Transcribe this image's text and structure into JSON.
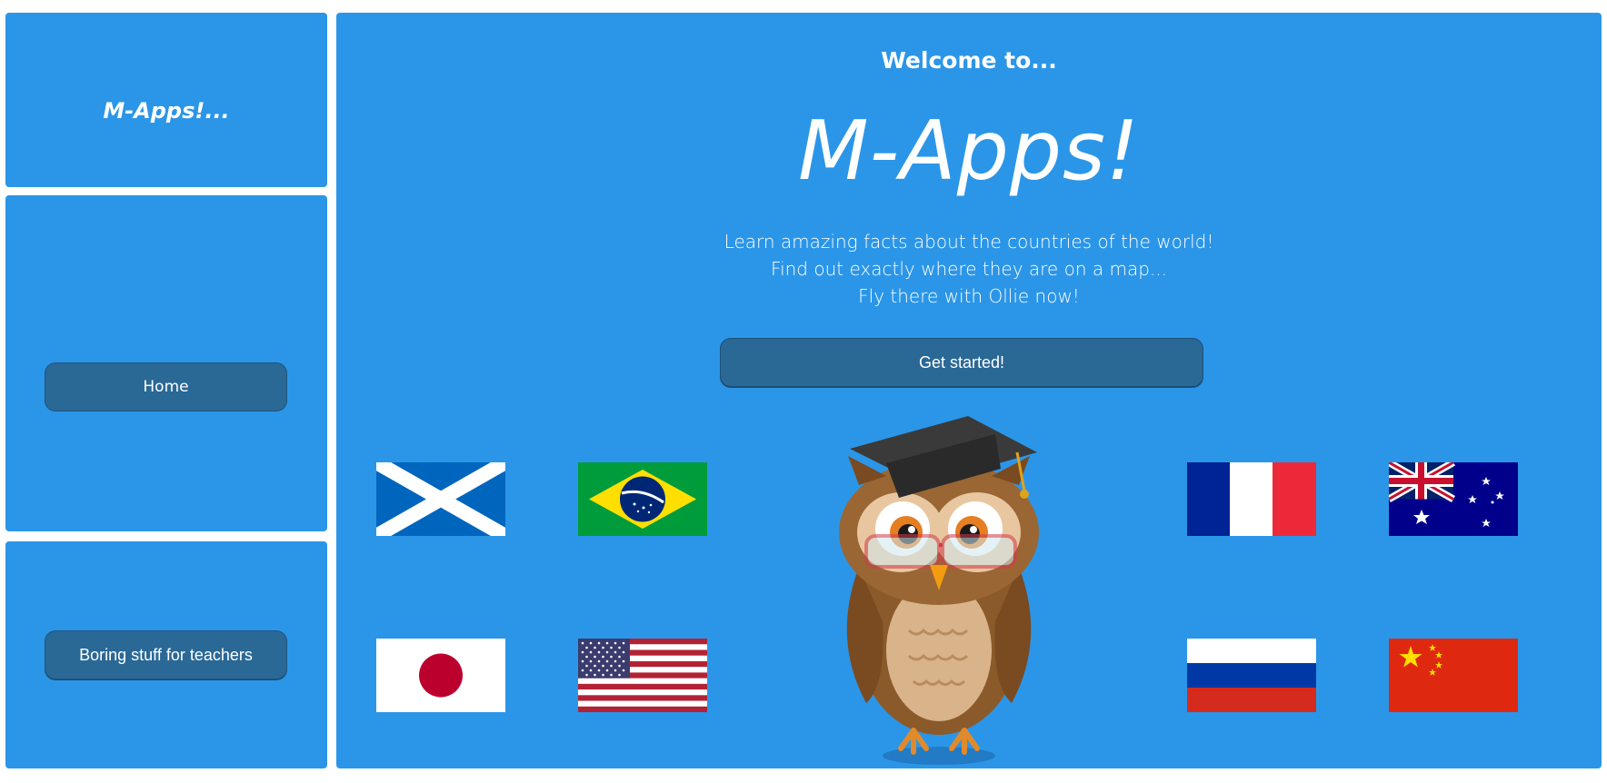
{
  "sidebar": {
    "logo": "M-Apps!...",
    "home_label": "Home",
    "teachers_label": "Boring stuff for teachers"
  },
  "main": {
    "welcome": "Welcome to...",
    "title": "M-Apps!",
    "taglines": [
      "Learn amazing facts about the countries of the world!",
      "Find out exactly where they are on a map...",
      "Fly there with Ollie now!"
    ],
    "cta_label": "Get started!"
  },
  "flags": [
    "scotland-flag",
    "brazil-flag",
    "france-flag",
    "australia-flag",
    "japan-flag",
    "usa-flag",
    "russia-flag",
    "china-flag"
  ],
  "mascot": "graduate-owl-mascot",
  "colors": {
    "panel": "#2b96e8",
    "button": "#2a6896",
    "text": "#ffffff"
  }
}
